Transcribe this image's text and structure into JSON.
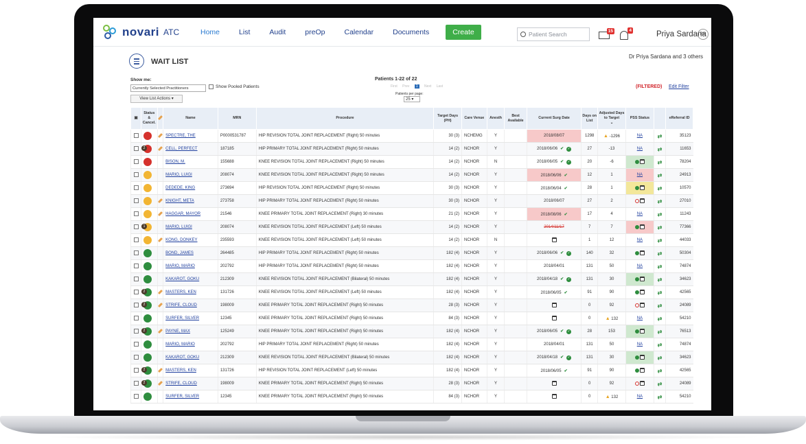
{
  "app": {
    "brand": "novari",
    "product": "ATC"
  },
  "nav": {
    "items": [
      {
        "label": "Home"
      },
      {
        "label": "List"
      },
      {
        "label": "Audit"
      },
      {
        "label": "preOp"
      },
      {
        "label": "Calendar"
      },
      {
        "label": "Documents"
      }
    ],
    "create": "Create",
    "search_placeholder": "Patient Search",
    "messages_badge": "15",
    "alerts_badge": "4",
    "user": "Priya Sardana",
    "initials": "PS"
  },
  "page": {
    "title": "WAIT LIST",
    "doctor_filter": "Dr Priya Sardana and 3 others",
    "show_me": "Show me:",
    "selected_view": "Currently Selected Practitioners",
    "pooled_label": "Show Pooled Patients",
    "view_actions": "View List Actions",
    "patients_count": "Patients 1-22 of 22",
    "pager": [
      "First",
      "Prev",
      "1",
      "Next",
      "Last"
    ],
    "per_page_label": "Patients per page:",
    "per_page": "25",
    "filtered": "(FILTERED)",
    "edit_filter": "Edit Filter"
  },
  "columns": [
    "Status & Cancel.",
    "Name",
    "MRN",
    "Procedure",
    "Target Days (PH)",
    "Care Venue",
    "Anesth",
    "Best Available",
    "Current Surg Date",
    "Days on List",
    "Adjusted Days to Target",
    "PSS Status",
    "eReferral ID"
  ],
  "colors": {
    "red": "#d5312c",
    "yellow": "#f2b533",
    "green": "#2e8d3e",
    "link": "#1f3f9e",
    "header_bg": "#e8eef6"
  },
  "rows": [
    {
      "status": "red",
      "mini": "",
      "pencil": true,
      "name": "SPECTRE, THE",
      "mrn": "P0000531787",
      "proc": "HIP REVISION TOTAL JOINT REPLACEMENT (Right) 50 minutes",
      "tgt": "30 (3)",
      "cv": "NCHEMG",
      "an": "Y",
      "surg": "2018/08/07",
      "surg_bg": "red",
      "surg_ok": false,
      "surg_chk": false,
      "dol": "1298",
      "adj": "-1296",
      "adj_warn": true,
      "pss": "NA",
      "pss_bg": "",
      "ref": "35123"
    },
    {
      "status": "red",
      "mini": "2",
      "pencil": true,
      "name": "CELL, PERFECT",
      "mrn": "187185",
      "proc": "HIP PRIMARY TOTAL JOINT REPLACEMENT (Right) 50 minutes",
      "tgt": "14 (2)",
      "cv": "NCHOR",
      "an": "Y",
      "surg": "2018/06/06",
      "surg_bg": "",
      "surg_ok": true,
      "surg_chk": true,
      "dol": "27",
      "adj": "-13",
      "adj_warn": false,
      "pss": "NA",
      "pss_bg": "",
      "ref": "11653"
    },
    {
      "status": "red",
      "mini": "",
      "pencil": false,
      "name": "BISON, M.",
      "mrn": "155688",
      "proc": "KNEE REVISION TOTAL JOINT REPLACEMENT (Right) 50 minutes",
      "tgt": "14 (2)",
      "cv": "NCHOR",
      "an": "N",
      "surg": "2018/06/05",
      "surg_bg": "",
      "surg_ok": true,
      "surg_chk": true,
      "dol": "20",
      "adj": "-6",
      "adj_warn": false,
      "pss": "okcal",
      "pss_bg": "green",
      "ref": "78204"
    },
    {
      "status": "yellow",
      "mini": "",
      "pencil": false,
      "name": "MARIO, LUIGI",
      "mrn": "208074",
      "proc": "KNEE REVISION TOTAL JOINT REPLACEMENT (Right) 50 minutes",
      "tgt": "14 (2)",
      "cv": "NCHOR",
      "an": "Y",
      "surg": "2018/06/06",
      "surg_bg": "red",
      "surg_ok": true,
      "surg_chk": false,
      "dol": "12",
      "adj": "1",
      "adj_warn": false,
      "pss": "NA",
      "pss_bg": "red",
      "ref": "24913"
    },
    {
      "status": "yellow",
      "mini": "",
      "pencil": false,
      "name": "DEDEDE, KING",
      "mrn": "273694",
      "proc": "HIP REVISION TOTAL JOINT REPLACEMENT (Right) 50 minutes",
      "tgt": "30 (3)",
      "cv": "NCHOR",
      "an": "Y",
      "surg": "2018/06/04",
      "surg_bg": "",
      "surg_ok": true,
      "surg_chk": false,
      "dol": "28",
      "adj": "1",
      "adj_warn": false,
      "pss": "okcal",
      "pss_bg": "yellow",
      "ref": "10570"
    },
    {
      "status": "yellow",
      "mini": "",
      "pencil": true,
      "name": "KNIGHT, META",
      "mrn": "273758",
      "proc": "HIP PRIMARY TOTAL JOINT REPLACEMENT (Right) 50 minutes",
      "tgt": "30 (3)",
      "cv": "NCHOR",
      "an": "Y",
      "surg": "2018/06/07",
      "surg_bg": "",
      "surg_ok": false,
      "surg_chk": false,
      "dol": "27",
      "adj": "2",
      "adj_warn": false,
      "pss": "nocal",
      "pss_bg": "",
      "ref": "27010"
    },
    {
      "status": "yellow",
      "mini": "",
      "pencil": true,
      "name": "HAGGAR, MAYOR",
      "mrn": "21546",
      "proc": "KNEE PRIMARY TOTAL JOINT REPLACEMENT (Right) 30 minutes",
      "tgt": "21 (2)",
      "cv": "NCHOR",
      "an": "Y",
      "surg": "2018/08/06",
      "surg_bg": "red",
      "surg_ok": true,
      "surg_chk": false,
      "dol": "17",
      "adj": "4",
      "adj_warn": false,
      "pss": "NA",
      "pss_bg": "",
      "ref": "11243"
    },
    {
      "status": "yellow",
      "mini": "1",
      "pencil": false,
      "name": "MARIO, LUIGI",
      "mrn": "208074",
      "proc": "KNEE REVISION TOTAL JOINT REPLACEMENT (Left) 50 minutes",
      "tgt": "14 (2)",
      "cv": "NCHOR",
      "an": "Y",
      "surg": "2014/11/17",
      "surg_bg": "",
      "surg_ok": false,
      "surg_chk": false,
      "surg_strike": true,
      "dol": "7",
      "adj": "7",
      "adj_warn": false,
      "pss": "okcal",
      "pss_bg": "red",
      "ref": "77366"
    },
    {
      "status": "yellow",
      "mini": "",
      "pencil": true,
      "name": "KONG, DONKEY",
      "mrn": "235593",
      "proc": "KNEE REVISION TOTAL JOINT REPLACEMENT (Left) 50 minutes",
      "tgt": "14 (2)",
      "cv": "NCHOR",
      "an": "N",
      "surg": "",
      "surg_cal": true,
      "surg_bg": "",
      "surg_ok": false,
      "surg_chk": false,
      "dol": "1",
      "adj": "12",
      "adj_warn": false,
      "pss": "NA",
      "pss_bg": "",
      "ref": "44033"
    },
    {
      "status": "green",
      "mini": "",
      "pencil": false,
      "name": "BOND, JAMES",
      "mrn": "264485",
      "proc": "HIP PRIMARY TOTAL JOINT REPLACEMENT (Right) 50 minutes",
      "tgt": "182 (4)",
      "cv": "NCHOR",
      "an": "Y",
      "surg": "2018/06/06",
      "surg_bg": "",
      "surg_ok": true,
      "surg_chk": true,
      "dol": "140",
      "adj": "32",
      "adj_warn": false,
      "pss": "okcal",
      "pss_bg": "",
      "ref": "50304"
    },
    {
      "status": "green",
      "mini": "",
      "pencil": false,
      "name": "MARIO, MARIO",
      "mrn": "202792",
      "proc": "HIP PRIMARY TOTAL JOINT REPLACEMENT (Right) 50 minutes",
      "tgt": "182 (4)",
      "cv": "NCHOR",
      "an": "Y",
      "surg": "2018/04/01",
      "surg_bg": "",
      "surg_ok": false,
      "surg_chk": false,
      "dol": "131",
      "adj": "50",
      "adj_warn": false,
      "pss": "NA",
      "pss_bg": "",
      "ref": "74874"
    },
    {
      "status": "green",
      "mini": "",
      "pencil": false,
      "name": "KAKAROT, GOKU",
      "mrn": "212309",
      "proc": "KNEE REVISION TOTAL JOINT REPLACEMENT (Bilateral) 50 minutes",
      "tgt": "182 (4)",
      "cv": "NCHOR",
      "an": "Y",
      "surg": "2018/04/18",
      "surg_bg": "",
      "surg_ok": true,
      "surg_chk": true,
      "dol": "131",
      "adj": "30",
      "adj_warn": false,
      "pss": "okcal",
      "pss_bg": "green",
      "ref": "34623"
    },
    {
      "status": "green",
      "mini": "2",
      "pencil": true,
      "name": "MASTERS, KEN",
      "mrn": "131726",
      "proc": "KNEE REVISION TOTAL JOINT REPLACEMENT (Left) 50 minutes",
      "tgt": "182 (4)",
      "cv": "NCHOR",
      "an": "Y",
      "surg": "2018/06/05",
      "surg_bg": "",
      "surg_ok": true,
      "surg_chk": false,
      "dol": "91",
      "adj": "90",
      "adj_warn": false,
      "pss": "okcal",
      "pss_bg": "",
      "ref": "42565"
    },
    {
      "status": "green",
      "mini": "2",
      "pencil": true,
      "name": "STRIFE, CLOUD",
      "mrn": "198009",
      "proc": "KNEE PRIMARY TOTAL JOINT REPLACEMENT (Right) 50 minutes",
      "tgt": "28 (3)",
      "cv": "NCHOR",
      "an": "Y",
      "surg": "",
      "surg_cal": true,
      "surg_bg": "",
      "surg_ok": false,
      "surg_chk": false,
      "dol": "0",
      "adj": "92",
      "adj_warn": false,
      "pss": "nocal",
      "pss_bg": "",
      "ref": "24089"
    },
    {
      "status": "green",
      "mini": "",
      "pencil": false,
      "name": "SURFER, SILVER",
      "mrn": "12345",
      "proc": "KNEE PRIMARY TOTAL JOINT REPLACEMENT (Right) 50 minutes",
      "tgt": "84 (3)",
      "cv": "NCHOR",
      "an": "Y",
      "surg": "",
      "surg_cal": true,
      "surg_bg": "",
      "surg_ok": false,
      "surg_chk": false,
      "dol": "0",
      "adj": "132",
      "adj_warn": true,
      "pss": "NA",
      "pss_bg": "",
      "ref": "54210"
    },
    {
      "status": "green",
      "mini": "2",
      "pencil": true,
      "name": "PAYNE, MAX",
      "mrn": "125249",
      "proc": "KNEE PRIMARY TOTAL JOINT REPLACEMENT (Right) 50 minutes",
      "tgt": "182 (4)",
      "cv": "NCHOR",
      "an": "Y",
      "surg": "2018/06/05",
      "surg_bg": "",
      "surg_ok": true,
      "surg_chk": true,
      "dol": "28",
      "adj": "153",
      "adj_warn": false,
      "pss": "okcal",
      "pss_bg": "green",
      "ref": "76513"
    },
    {
      "status": "green",
      "mini": "",
      "pencil": false,
      "name": "MARIO, MARIO",
      "mrn": "202792",
      "proc": "HIP PRIMARY TOTAL JOINT REPLACEMENT (Right) 50 minutes",
      "tgt": "182 (4)",
      "cv": "NCHOR",
      "an": "Y",
      "surg": "2018/04/01",
      "surg_bg": "",
      "surg_ok": false,
      "surg_chk": false,
      "dol": "131",
      "adj": "50",
      "adj_warn": false,
      "pss": "NA",
      "pss_bg": "",
      "ref": "74874"
    },
    {
      "status": "green",
      "mini": "",
      "pencil": false,
      "name": "KAKAROT, GOKU",
      "mrn": "212309",
      "proc": "KNEE REVISION TOTAL JOINT REPLACEMENT (Bilateral) 50 minutes",
      "tgt": "182 (4)",
      "cv": "NCHOR",
      "an": "Y",
      "surg": "2018/04/18",
      "surg_bg": "",
      "surg_ok": true,
      "surg_chk": true,
      "dol": "131",
      "adj": "30",
      "adj_warn": false,
      "pss": "okcal",
      "pss_bg": "green",
      "ref": "34623"
    },
    {
      "status": "green",
      "mini": "2",
      "pencil": true,
      "name": "MASTERS, KEN",
      "mrn": "131726",
      "proc": "HIP REVISION TOTAL JOINT REPLACEMENT (Left) 50 minutes",
      "tgt": "182 (4)",
      "cv": "NCHOR",
      "an": "Y",
      "surg": "2018/06/05",
      "surg_bg": "",
      "surg_ok": true,
      "surg_chk": false,
      "dol": "91",
      "adj": "90",
      "adj_warn": false,
      "pss": "okcal",
      "pss_bg": "",
      "ref": "42565"
    },
    {
      "status": "green",
      "mini": "2",
      "pencil": true,
      "name": "STRIFE, CLOUD",
      "mrn": "198009",
      "proc": "KNEE PRIMARY TOTAL JOINT REPLACEMENT (Right) 50 minutes",
      "tgt": "28 (3)",
      "cv": "NCHOR",
      "an": "Y",
      "surg": "",
      "surg_cal": true,
      "surg_bg": "",
      "surg_ok": false,
      "surg_chk": false,
      "dol": "0",
      "adj": "92",
      "adj_warn": false,
      "pss": "nocal",
      "pss_bg": "",
      "ref": "24089"
    },
    {
      "status": "green",
      "mini": "",
      "pencil": false,
      "name": "SURFER, SILVER",
      "mrn": "12345",
      "proc": "KNEE PRIMARY TOTAL JOINT REPLACEMENT (Right) 50 minutes",
      "tgt": "84 (3)",
      "cv": "NCHOR",
      "an": "Y",
      "surg": "",
      "surg_cal": true,
      "surg_bg": "",
      "surg_ok": false,
      "surg_chk": false,
      "dol": "0",
      "adj": "132",
      "adj_warn": true,
      "pss": "NA",
      "pss_bg": "",
      "ref": "54210"
    }
  ]
}
